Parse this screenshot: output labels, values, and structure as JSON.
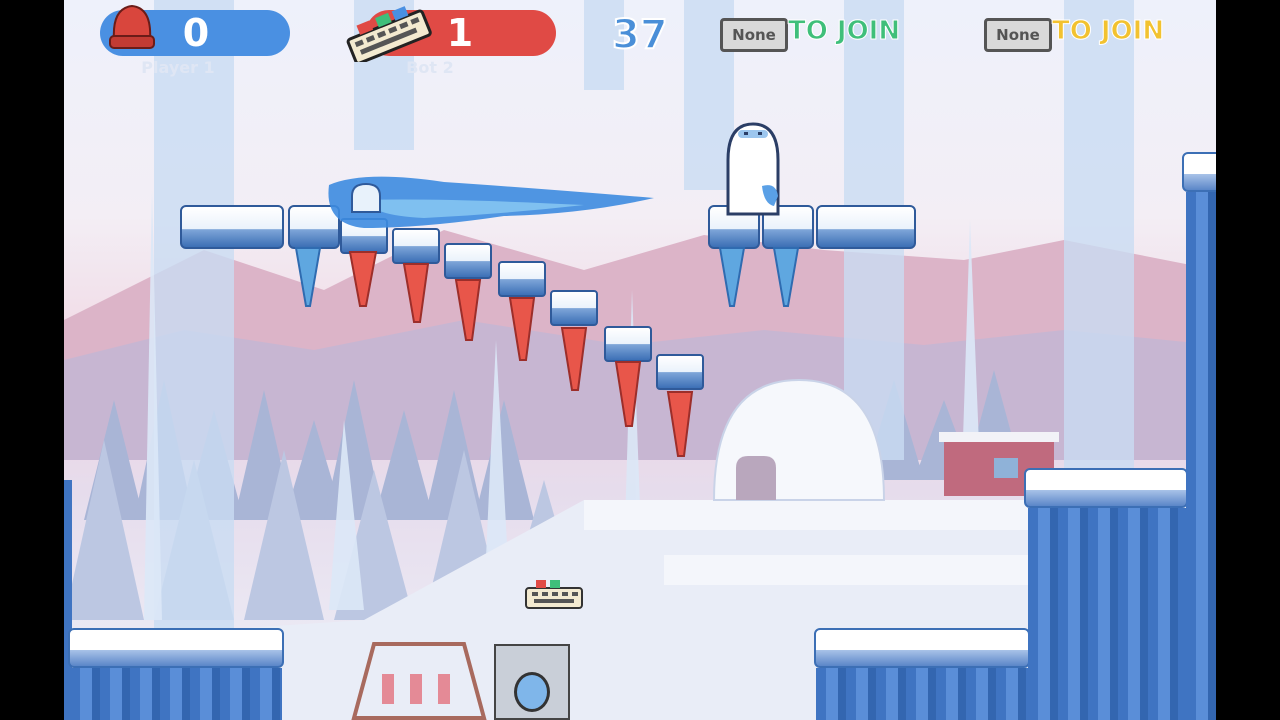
{
  "hud": {
    "player1": {
      "score": "0",
      "name": "Player 1",
      "color": "#4a90e2",
      "icon": "red-beanie-icon"
    },
    "bot2": {
      "score": "1",
      "name": "Bot 2",
      "color": "#e04a45",
      "icon": "keyboard-icon"
    },
    "timer": "37",
    "slot3": {
      "none_label": "None",
      "join_label": "TO JOIN",
      "color": "#3fbf7a"
    },
    "slot4": {
      "none_label": "None",
      "join_label": "TO JOIN",
      "color": "#f2c230"
    }
  },
  "scene": {
    "theme": "snowy-ice-level",
    "characters": [
      "yeti-character",
      "keyboard-pickup"
    ]
  }
}
